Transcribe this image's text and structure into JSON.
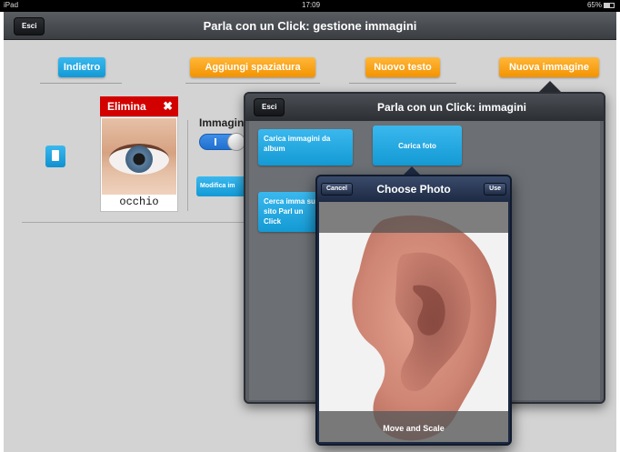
{
  "status_bar": {
    "device": "iPad",
    "time": "17:09",
    "battery": "65%"
  },
  "navbar": {
    "title": "Parla con un Click: gestione immagini",
    "esc_label": "Esci"
  },
  "toolbar": {
    "back_label": "Indietro",
    "add_spacing_label": "Aggiungi spaziatura",
    "new_text_label": "Nuovo testo",
    "new_image_label": "Nuova immagine"
  },
  "card": {
    "delete_label": "Elimina",
    "delete_icon": "✖",
    "image_caption": "occhio",
    "image_icon": "eye-photo"
  },
  "settings": {
    "image_label": "Immagin",
    "edit_label": "Modifica im"
  },
  "images_popover": {
    "title": "Parla con un Click: immagini",
    "esc_label": "Esci",
    "load_album_label": "Carica immagini da album",
    "load_photo_label": "Carica foto",
    "search_site_label": "Cerca imma sul sito Parl un Click"
  },
  "choose_photo": {
    "title": "Choose Photo",
    "cancel_label": "Cancel",
    "use_label": "Use",
    "footer_label": "Move and Scale",
    "photo_icon": "ear-photo"
  },
  "colors": {
    "blue": "#1aa3e0",
    "orange": "#f59a10",
    "red": "#d30000",
    "navbar": "#3a3d42"
  }
}
